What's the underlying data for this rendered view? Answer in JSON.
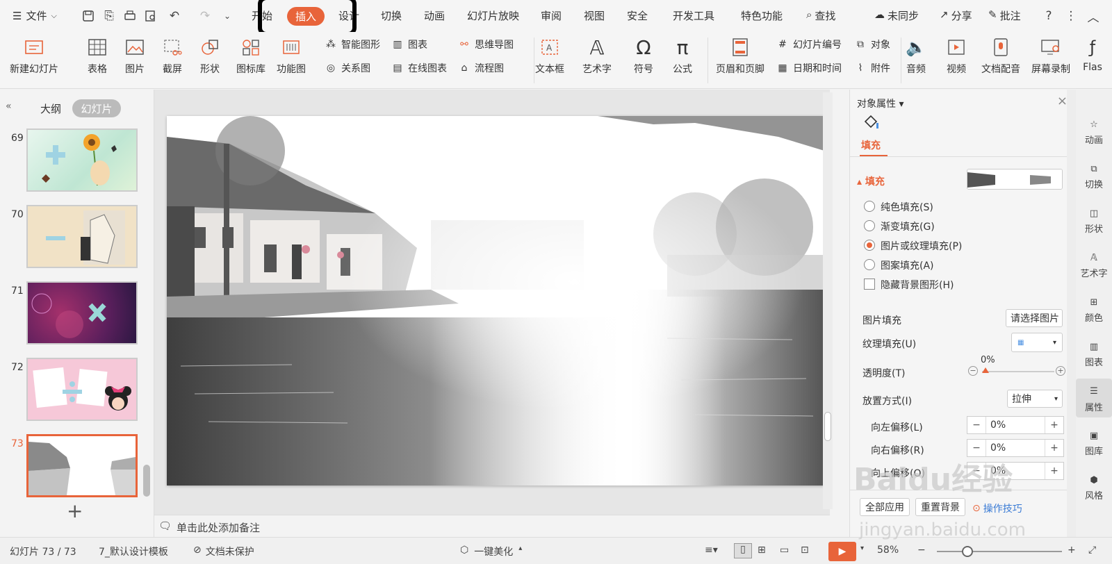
{
  "menubar": {
    "file_label": "文件",
    "tabs": [
      "开始",
      "插入",
      "设计",
      "切换",
      "动画",
      "幻灯片放映",
      "审阅",
      "视图",
      "安全",
      "开发工具",
      "特色功能"
    ],
    "search_label": "查找",
    "sync_label": "未同步",
    "share_label": "分享",
    "comment_label": "批注"
  },
  "ribbon": {
    "new_slide": "新建幻灯片",
    "table": "表格",
    "picture": "图片",
    "screenshot": "截屏",
    "shape": "形状",
    "icon_lib": "图标库",
    "func_chart": "功能图",
    "smart_graphic": "智能图形",
    "chart": "图表",
    "relation": "关系图",
    "online_chart": "在线图表",
    "mindmap": "思维导图",
    "flowchart": "流程图",
    "textbox": "文本框",
    "wordart": "艺术字",
    "symbol": "符号",
    "formula": "公式",
    "header_footer": "页眉和页脚",
    "slide_number": "幻灯片编号",
    "object": "对象",
    "datetime": "日期和时间",
    "attachment": "附件",
    "audio": "音频",
    "video": "视频",
    "doc_dub": "文档配音",
    "screen_record": "屏幕录制",
    "flash": "Flas"
  },
  "leftpanel": {
    "outline_tab": "大纲",
    "slides_tab": "幻灯片",
    "thumbs": [
      "69",
      "70",
      "71",
      "72",
      "73"
    ],
    "add_label": "+"
  },
  "notes": {
    "placeholder": "单击此处添加备注"
  },
  "props": {
    "title": "对象属性",
    "fill_tab": "填充",
    "section_fill": "填充",
    "options": [
      "纯色填充(S)",
      "渐变填充(G)",
      "图片或纹理填充(P)",
      "图案填充(A)"
    ],
    "hide_bg": "隐藏背景图形(H)",
    "picture_fill_label": "图片填充",
    "picture_fill_btn": "请选择图片",
    "texture_label": "纹理填充(U)",
    "transparency_label": "透明度(T)",
    "transparency_value": "0%",
    "placement_label": "放置方式(I)",
    "placement_value": "拉伸",
    "offset_left_label": "向左偏移(L)",
    "offset_left_value": "0%",
    "offset_right_label": "向右偏移(R)",
    "offset_right_value": "0%",
    "offset_top_label": "向上偏移(O)",
    "offset_top_value": "0%",
    "apply_all": "全部应用",
    "reset_bg": "重置背景",
    "tips": "操作技巧"
  },
  "sidebar": [
    "动画",
    "切换",
    "形状",
    "艺术字",
    "颜色",
    "图表",
    "属性",
    "图库",
    "风格"
  ],
  "status": {
    "slide_info": "幻灯片 73 / 73",
    "template": "7_默认设计模板",
    "protect": "文档未保护",
    "beautify": "一键美化",
    "zoom": "58%"
  },
  "watermark": {
    "logo": "Baidu经验",
    "url": "jingyan.baidu.com"
  },
  "colors": {
    "accent": "#e8643a"
  }
}
